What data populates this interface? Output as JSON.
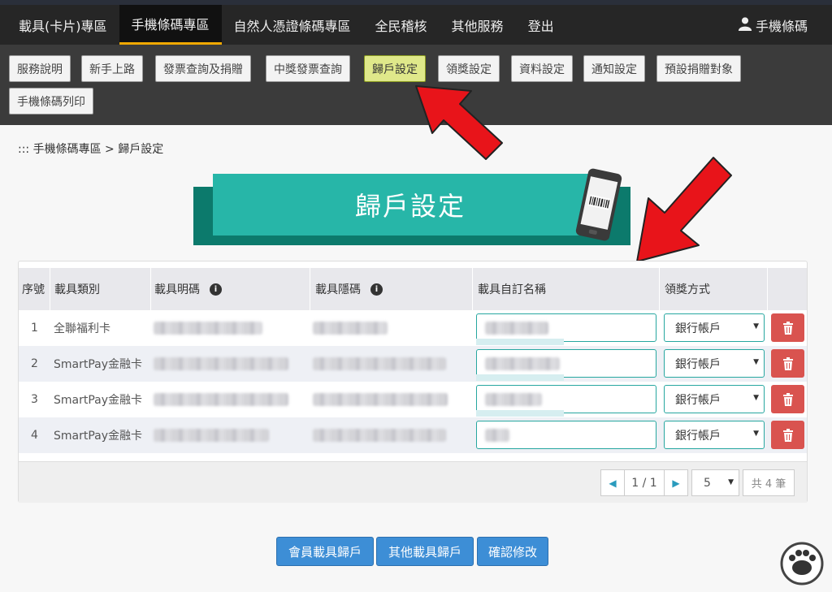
{
  "topnav": {
    "items": [
      "載具(卡片)專區",
      "手機條碼專區",
      "自然人憑證條碼專區",
      "全民稽核",
      "其他服務",
      "登出"
    ],
    "active_index": 1,
    "user_label": "手機條碼"
  },
  "subnav": {
    "items": [
      "服務說明",
      "新手上路",
      "發票查詢及捐贈",
      "中獎發票查詢",
      "歸戶設定",
      "領獎設定",
      "資料設定",
      "通知設定",
      "預設捐贈對象",
      "手機條碼列印"
    ],
    "active_index": 4
  },
  "breadcrumb": ":::  手機條碼專區 > 歸戶設定",
  "banner": {
    "title": "歸戶設定"
  },
  "table": {
    "headers": [
      "序號",
      "載具類別",
      "載具明碼",
      "載具隱碼",
      "載具自訂名稱",
      "領獎方式"
    ],
    "info_icon_glyph": "i",
    "rows": [
      {
        "no": "1",
        "type": "全聯福利卡",
        "method": "銀行帳戶"
      },
      {
        "no": "2",
        "type": "SmartPay金融卡",
        "method": "銀行帳戶"
      },
      {
        "no": "3",
        "type": "SmartPay金融卡",
        "method": "銀行帳戶"
      },
      {
        "no": "4",
        "type": "SmartPay金融卡",
        "method": "銀行帳戶"
      }
    ],
    "pager": {
      "prev": "◀",
      "page": "1 / 1",
      "next": "▶",
      "page_size": "5",
      "total": "共 4 筆"
    }
  },
  "actions": [
    "會員載具歸戶",
    "其他載具歸戶",
    "確認修改"
  ],
  "colors": {
    "accent": "#f0a800",
    "teal": "#27b6a8",
    "danger": "#d9534f",
    "primary": "#3d8ed6",
    "arrow": "#e8141a"
  },
  "icons": [
    "user-icon",
    "info-icon",
    "trash-icon",
    "caret-down-icon",
    "phone-barcode-icon",
    "red-arrow-icon"
  ]
}
